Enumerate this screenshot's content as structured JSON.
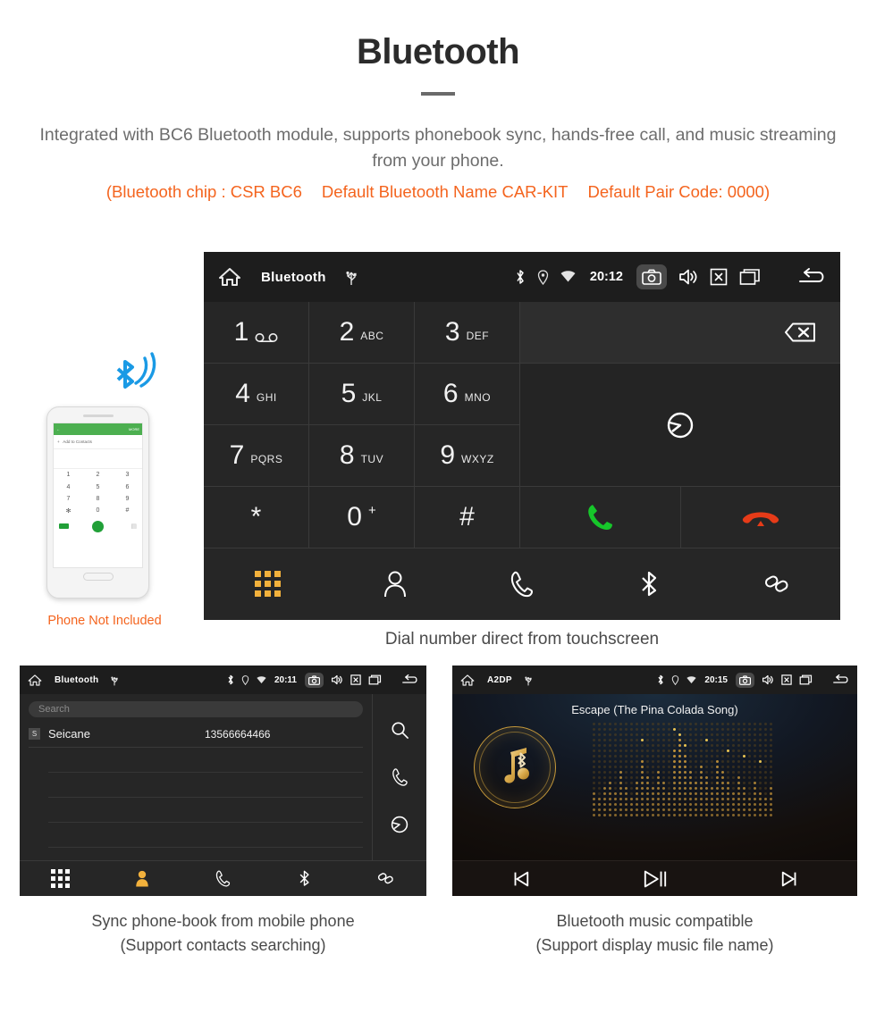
{
  "header": {
    "title": "Bluetooth",
    "subtitle": "Integrated with BC6 Bluetooth module, supports phonebook sync, hands-free call, and music streaming from your phone.",
    "specs": {
      "chip": "(Bluetooth chip : CSR BC6",
      "name": "Default Bluetooth Name CAR-KIT",
      "pair_code": "Default Pair Code: 0000)"
    },
    "accent_color": "#f4641e",
    "text_color": "#6d6d6d"
  },
  "dialer": {
    "statusbar": {
      "title": "Bluetooth",
      "time": "20:12",
      "icons_left": [
        "home-icon",
        "usb-icon"
      ],
      "icons_right": [
        "bluetooth-icon",
        "location-icon",
        "wifi-icon",
        "camera-icon",
        "volume-icon",
        "close-icon",
        "recents-icon",
        "back-icon"
      ]
    },
    "keys": [
      {
        "num": "1",
        "sub": "",
        "icon": "voicemail-icon"
      },
      {
        "num": "2",
        "sub": "ABC",
        "icon": ""
      },
      {
        "num": "3",
        "sub": "DEF",
        "icon": ""
      },
      {
        "num": "4",
        "sub": "GHI",
        "icon": ""
      },
      {
        "num": "5",
        "sub": "JKL",
        "icon": ""
      },
      {
        "num": "6",
        "sub": "MNO",
        "icon": ""
      },
      {
        "num": "7",
        "sub": "PQRS",
        "icon": ""
      },
      {
        "num": "8",
        "sub": "TUV",
        "icon": ""
      },
      {
        "num": "9",
        "sub": "WXYZ",
        "icon": ""
      },
      {
        "num": "*",
        "sub": "",
        "icon": ""
      },
      {
        "num": "0",
        "sub": "",
        "sup": "+",
        "icon": ""
      },
      {
        "num": "#",
        "sub": "",
        "icon": ""
      }
    ],
    "actions": {
      "backspace": "backspace-icon",
      "sync": "sync-icon",
      "call": "call-icon",
      "hangup": "hangup-icon",
      "call_color": "#16c62a",
      "hangup_color": "#e63b18"
    },
    "bottom_nav": [
      {
        "name": "keypad",
        "icon": "keypad-grid-icon",
        "active": true
      },
      {
        "name": "contacts",
        "icon": "person-icon",
        "active": false
      },
      {
        "name": "call-log",
        "icon": "handset-icon",
        "active": false
      },
      {
        "name": "bluetooth",
        "icon": "bluetooth-icon",
        "active": false
      },
      {
        "name": "pair-link",
        "icon": "link-icon",
        "active": false
      }
    ],
    "active_color": "#f2b13c",
    "caption": "Dial number direct from touchscreen"
  },
  "phone_mockup": {
    "header_action": "MORE",
    "add_to_contacts": "Add to Contacts",
    "keys": [
      "1",
      "2",
      "3",
      "4",
      "5",
      "6",
      "7",
      "8",
      "9",
      "*",
      "0",
      "#"
    ],
    "note": "Phone Not Included",
    "note_color": "#f4641e",
    "bluetooth_icon": "bluetooth-signal-icon"
  },
  "phonebook": {
    "statusbar": {
      "title": "Bluetooth",
      "time": "20:11"
    },
    "search": {
      "placeholder": "Search",
      "value": ""
    },
    "columns": [
      "name",
      "number"
    ],
    "contacts": [
      {
        "badge": "S",
        "name": "Seicane",
        "number": "13566664466"
      }
    ],
    "empty_rows": 4,
    "rail_icons": [
      "search-icon",
      "handset-icon",
      "sync-icon"
    ],
    "bottom_nav": [
      {
        "name": "keypad",
        "icon": "keypad-grid-icon",
        "active": false
      },
      {
        "name": "contacts",
        "icon": "person-icon",
        "active": true
      },
      {
        "name": "call-log",
        "icon": "handset-icon",
        "active": false
      },
      {
        "name": "bluetooth",
        "icon": "bluetooth-icon",
        "active": false
      },
      {
        "name": "pair-link",
        "icon": "link-icon",
        "active": false
      }
    ],
    "caption_line1": "Sync phone-book from mobile phone",
    "caption_line2": "(Support contacts searching)"
  },
  "music": {
    "statusbar": {
      "title": "A2DP",
      "time": "20:15"
    },
    "track_title": "Escape (The Pina Colada Song)",
    "logo_icon": "music-note-bluetooth-icon",
    "visualizer": "dot-matrix-spectrum",
    "controls": [
      {
        "name": "previous",
        "icon": "prev-track-icon"
      },
      {
        "name": "play-pause",
        "icon": "play-pause-icon"
      },
      {
        "name": "next",
        "icon": "next-track-icon"
      }
    ],
    "accent_color": "#c79a3a",
    "caption_line1": "Bluetooth music compatible",
    "caption_line2": "(Support display music file name)"
  }
}
